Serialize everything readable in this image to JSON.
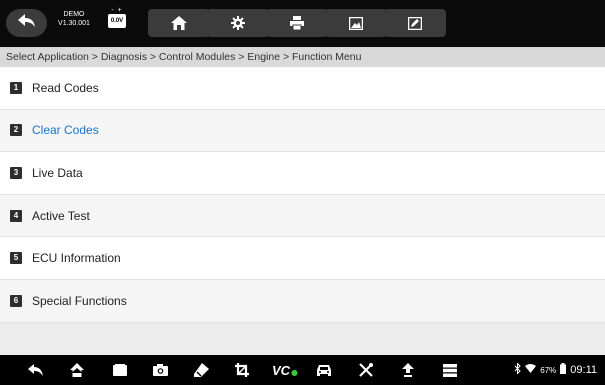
{
  "header": {
    "app_name": "DEMO",
    "version": "V1.30.001",
    "battery_voltage": "0.0V",
    "battery_terminals": "- +"
  },
  "breadcrumb": "Select Application > Diagnosis > Control Modules > Engine > Function Menu",
  "menu": {
    "items": [
      {
        "number": "1",
        "label": "Read Codes"
      },
      {
        "number": "2",
        "label": "Clear Codes"
      },
      {
        "number": "3",
        "label": "Live Data"
      },
      {
        "number": "4",
        "label": "Active Test"
      },
      {
        "number": "5",
        "label": "ECU Information"
      },
      {
        "number": "6",
        "label": "Special Functions"
      }
    ],
    "selected_index": 1
  },
  "toolbar_icons": [
    "back-icon",
    "home-icon",
    "settings-icon",
    "print-icon",
    "screenshot-icon",
    "edit-icon"
  ],
  "navbar_icons": [
    "back-icon",
    "home-icon",
    "recent-apps-icon",
    "camera-icon",
    "eraser-icon",
    "crop-icon",
    "vci-icon",
    "car-icon",
    "tools-icon",
    "update-icon",
    "menu-icon"
  ],
  "status_bar": {
    "vci_label": "VC",
    "battery_percent": "67%",
    "time": "09:11"
  },
  "colors": {
    "toolbar_bg": "#0b0b0b",
    "button_bg": "#3b3b3b",
    "selected_text": "#1a73c8",
    "vci_indicator": "#3cc83c"
  }
}
